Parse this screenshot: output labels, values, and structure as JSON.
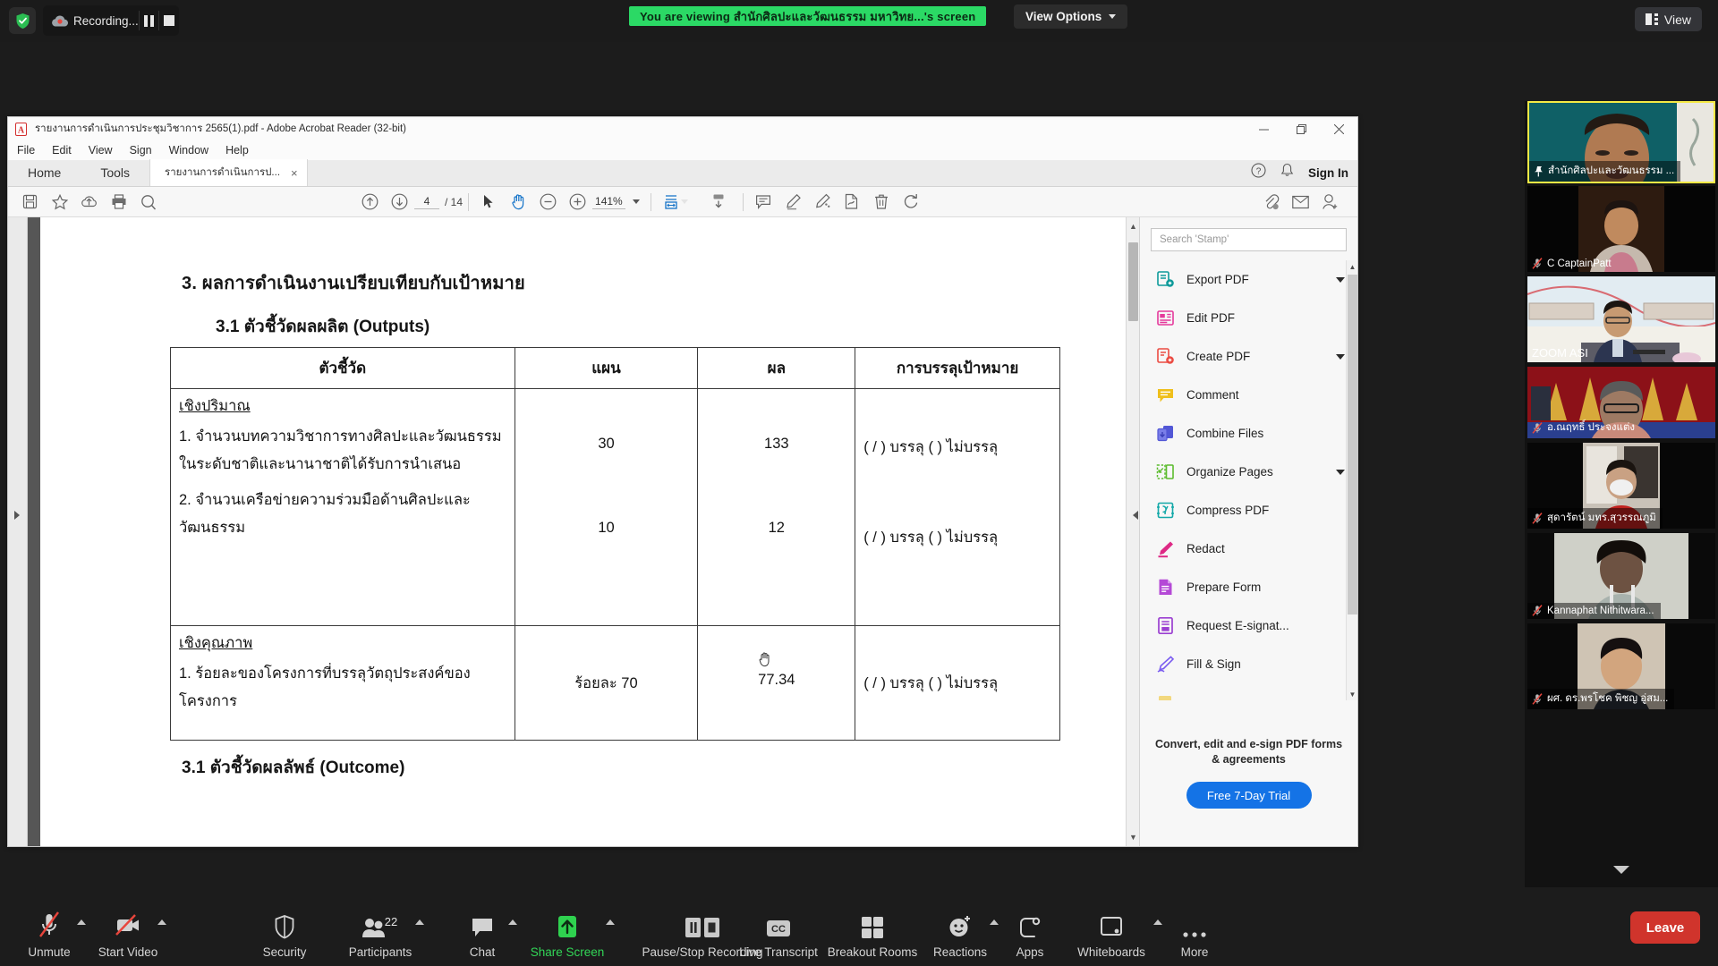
{
  "topbar": {
    "shield_icon": "shield-check-icon",
    "recording_label": "Recording...",
    "pause_icon": "pause-icon",
    "stop_icon": "stop-icon",
    "viewing_banner": "You are viewing สำนักศิลปะและวัฒนธรรม มหาวิทย...'s screen",
    "view_options_label": "View Options",
    "view_button_label": "View"
  },
  "acrobat": {
    "title": "รายงานการดำเนินการประชุมวิชาการ 2565(1).pdf - Adobe Acrobat Reader (32-bit)",
    "menu": [
      "File",
      "Edit",
      "View",
      "Sign",
      "Window",
      "Help"
    ],
    "tabs": [
      {
        "label": "Home"
      },
      {
        "label": "Tools"
      },
      {
        "label": "รายงานการดำเนินการป...",
        "close": "×"
      }
    ],
    "sign_in_label": "Sign In",
    "help_icon": "help-circle-icon",
    "bell_icon": "bell-icon",
    "window_controls": {
      "minimize": "minimize-icon",
      "maximize": "maximize-icon",
      "close": "close-icon"
    },
    "toolbar": {
      "save_icon": "save-icon",
      "star_icon": "star-icon",
      "upload_icon": "cloud-upload-icon",
      "print_icon": "print-icon",
      "search_icon": "search-icon",
      "prev_page_icon": "arrow-up-circle-icon",
      "next_page_icon": "arrow-down-circle-icon",
      "page_current": "4",
      "page_total": "/ 14",
      "select_icon": "cursor-select-icon",
      "hand_icon": "hand-tool-icon",
      "zoom_out_icon": "zoom-out-icon",
      "zoom_in_icon": "zoom-in-icon",
      "zoom_level": "141%",
      "fit_icon": "fit-page-icon",
      "scroll_icon": "scroll-mode-icon",
      "comment_icon": "comment-icon",
      "highlight_icon": "highlight-icon",
      "draw_icon": "draw-icon",
      "sign_icon": "sign-icon",
      "delete_icon": "trash-icon",
      "rotate_icon": "rotate-icon",
      "attach_icon": "attach-cloud-icon",
      "email_icon": "email-icon",
      "share_icon": "add-person-icon"
    }
  },
  "pdf": {
    "heading_1": "3.  ผลการดำเนินงานเปรียบเทียบกับเป้าหมาย",
    "heading_2": "3.1 ตัวชี้วัดผลผลิต (Outputs)",
    "heading_3": "3.1 ตัวชี้วัดผลลัพธ์ (Outcome)",
    "table": {
      "headers": [
        "ตัวชี้วัด",
        "แผน",
        "ผล",
        "การบรรลุเป้าหมาย"
      ],
      "sections": [
        {
          "title": "เชิงปริมาณ",
          "rows": [
            {
              "indicator": "1. จำนวนบทความวิชาการทางศิลปะและวัฒนธรรมในระดับชาติและนานาชาติได้รับการนำเสนอ",
              "plan": "30",
              "result": "133",
              "achievement": "( / ) บรรลุ (  ) ไม่บรรลุ"
            },
            {
              "indicator": "2. จำนวนเครือข่ายความร่วมมือด้านศิลปะและวัฒนธรรม",
              "plan": "10",
              "result": "12",
              "achievement": "( / ) บรรลุ (  ) ไม่บรรลุ"
            }
          ]
        },
        {
          "title": "เชิงคุณภาพ",
          "rows": [
            {
              "indicator": "1. ร้อยละของโครงการที่บรรลุวัตถุประสงค์ของโครงการ",
              "plan": "ร้อยละ 70",
              "result": "77.34",
              "achievement": "( / ) บรรลุ (  ) ไม่บรรลุ"
            }
          ]
        }
      ]
    }
  },
  "tools_panel": {
    "search_placeholder": "Search 'Stamp'",
    "items": [
      {
        "label": "Export PDF",
        "icon": "export-pdf-icon",
        "chevron": true,
        "color": "#0d9a9a"
      },
      {
        "label": "Edit PDF",
        "icon": "edit-pdf-icon",
        "chevron": false,
        "color": "#e5399b"
      },
      {
        "label": "Create PDF",
        "icon": "create-pdf-icon",
        "chevron": true,
        "color": "#eb4b42"
      },
      {
        "label": "Comment",
        "icon": "comment-icon",
        "chevron": false,
        "color": "#efbf1c"
      },
      {
        "label": "Combine Files",
        "icon": "combine-files-icon",
        "chevron": false,
        "color": "#5257d6"
      },
      {
        "label": "Organize Pages",
        "icon": "organize-pages-icon",
        "chevron": true,
        "color": "#5cbc2e"
      },
      {
        "label": "Compress PDF",
        "icon": "compress-pdf-icon",
        "chevron": false,
        "color": "#13a8a8"
      },
      {
        "label": "Redact",
        "icon": "redact-icon",
        "chevron": false,
        "color": "#de2a86"
      },
      {
        "label": "Prepare Form",
        "icon": "prepare-form-icon",
        "chevron": false,
        "color": "#b449d6"
      },
      {
        "label": "Request E-signat...",
        "icon": "request-esign-icon",
        "chevron": false,
        "color": "#9b3fd1"
      },
      {
        "label": "Fill & Sign",
        "icon": "fill-sign-icon",
        "chevron": false,
        "color": "#7a5cf0"
      }
    ],
    "promo_text": "Convert, edit and e-sign PDF forms & agreements",
    "promo_button": "Free 7-Day Trial",
    "promo_color": "#1473e6"
  },
  "video_strip": {
    "participants": [
      {
        "name": "สำนักศิลปะและวัฒนธรรม ...",
        "active": true,
        "muted": false,
        "pinned": true,
        "bg": "#0e5d62"
      },
      {
        "name": "C CaptainPatt",
        "active": false,
        "muted": true,
        "pinned": false,
        "bg": "#120f0d"
      },
      {
        "name": "ZOOM ASI",
        "active": false,
        "muted": false,
        "pinned": false,
        "bg": "#c9d7df"
      },
      {
        "name": "อ.ณฤทธิ์ ประจงแต่ง",
        "active": false,
        "muted": true,
        "pinned": false,
        "bg": "#8c1118"
      },
      {
        "name": "สุดารัตน์ มทร.สุวรรณภูมิ",
        "active": false,
        "muted": true,
        "pinned": false,
        "bg": "#101010"
      },
      {
        "name": "Kannaphat Nithitwara...",
        "active": false,
        "muted": true,
        "pinned": false,
        "bg": "#b9bcb4"
      },
      {
        "name": "ผศ. ดร.พรโชค พิชญ อู่สม...",
        "active": false,
        "muted": true,
        "pinned": false,
        "bg": "#141414"
      }
    ],
    "scroll_down_icon": "chevron-down-icon"
  },
  "zoom_toolbar": {
    "items": [
      {
        "label": "Unmute",
        "icon": "mic-muted-icon",
        "caret": true,
        "green": false
      },
      {
        "label": "Start Video",
        "icon": "video-off-icon",
        "caret": true,
        "green": false
      },
      {
        "label": "Security",
        "icon": "shield-icon",
        "caret": false,
        "green": false
      },
      {
        "label": "Participants",
        "icon": "participants-icon",
        "caret": true,
        "green": false,
        "count": "22"
      },
      {
        "label": "Chat",
        "icon": "chat-icon",
        "caret": true,
        "green": false
      },
      {
        "label": "Share Screen",
        "icon": "share-screen-icon",
        "caret": true,
        "green": true
      },
      {
        "label": "Pause/Stop Recording",
        "icon": "pause-stop-icon",
        "caret": false,
        "green": false
      },
      {
        "label": "Live Transcript",
        "icon": "closed-caption-icon",
        "caret": false,
        "green": false
      },
      {
        "label": "Breakout Rooms",
        "icon": "breakout-rooms-icon",
        "caret": false,
        "green": false
      },
      {
        "label": "Reactions",
        "icon": "reactions-icon",
        "caret": true,
        "green": false
      },
      {
        "label": "Apps",
        "icon": "apps-icon",
        "caret": false,
        "green": false
      },
      {
        "label": "Whiteboards",
        "icon": "whiteboard-icon",
        "caret": true,
        "green": false
      },
      {
        "label": "More",
        "icon": "more-dots-icon",
        "caret": false,
        "green": false
      }
    ],
    "leave_label": "Leave",
    "leave_color": "#d0342c"
  }
}
